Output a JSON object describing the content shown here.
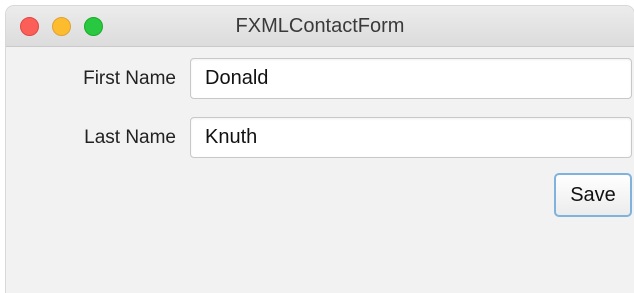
{
  "window": {
    "title": "FXMLContactForm",
    "controls": [
      {
        "name": "close-button",
        "color": "#fc5f57"
      },
      {
        "name": "minimize-button",
        "color": "#fdbc2e"
      },
      {
        "name": "zoom-button",
        "color": "#28c840"
      }
    ]
  },
  "form": {
    "first_name": {
      "label": "First Name",
      "value": "Donald"
    },
    "last_name": {
      "label": "Last Name",
      "value": "Knuth"
    },
    "save_label": "Save"
  },
  "colors": {
    "window_background": "#f2f2f2",
    "focus_accent": "#7fb3dd"
  }
}
